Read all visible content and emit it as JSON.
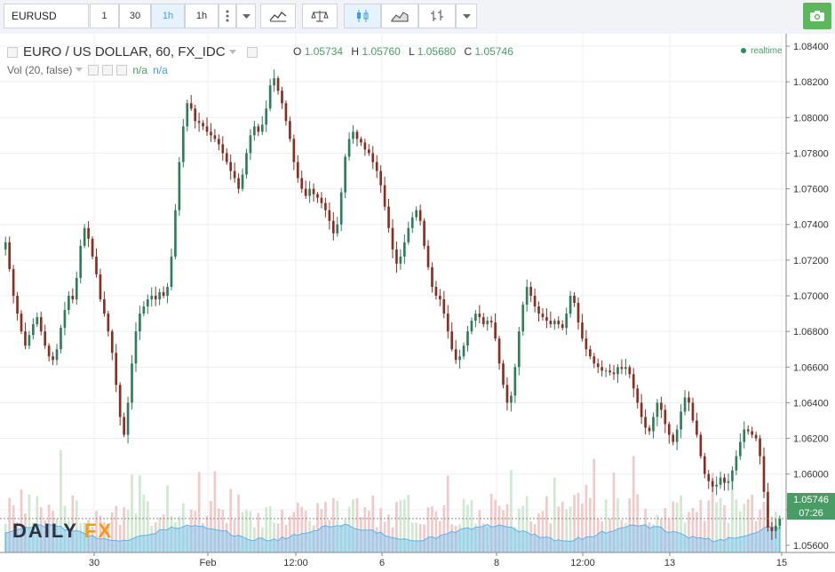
{
  "toolbar": {
    "symbol": "EURUSD",
    "intervals": [
      "1",
      "30",
      "1h",
      "1h"
    ],
    "active_interval_index": 2
  },
  "legend": {
    "title": "EURO / US DOLLAR, 60, FX_IDC",
    "ohlc": {
      "o_label": "O",
      "o": "1.05734",
      "h_label": "H",
      "h": "1.05760",
      "l_label": "L",
      "l": "1.05680",
      "c_label": "C",
      "c": "1.05746"
    },
    "volume_label": "Vol (20, false)",
    "volume_values": [
      "n/a",
      "n/a"
    ],
    "realtime": "realtime"
  },
  "price_tag": {
    "price": "1.05746",
    "countdown": "07:26"
  },
  "brand": {
    "part1": "DAILY",
    "part2": "FX"
  },
  "colors": {
    "up": "#2e7d5b",
    "down": "#8b2e22",
    "volume_up": "#cfe8cf",
    "volume_down": "#f0c9c9",
    "volume_area": "#7fc4ee",
    "accent": "#3aa0e6"
  },
  "chart_data": {
    "type": "candlestick",
    "title": "EURO / US DOLLAR, 60, FX_IDC",
    "y_axis": {
      "ticks": [
        "1.08400",
        "1.08200",
        "1.08000",
        "1.07800",
        "1.07600",
        "1.07400",
        "1.07200",
        "1.07000",
        "1.06800",
        "1.06600",
        "1.06400",
        "1.06200",
        "1.06000",
        "1.05800",
        "1.05600"
      ],
      "ylim": [
        1.0556,
        1.0842
      ]
    },
    "x_axis": {
      "ticks": [
        "30",
        "Feb",
        "12:00",
        "6",
        "8",
        "12:00",
        "13",
        "15"
      ]
    },
    "series": [
      {
        "name": "price",
        "values": [
          1.073,
          1.0715,
          1.07,
          1.069,
          1.068,
          1.0672,
          1.0678,
          1.0684,
          1.0688,
          1.068,
          1.0672,
          1.0666,
          1.0664,
          1.067,
          1.0682,
          1.0692,
          1.07,
          1.0698,
          1.071,
          1.0728,
          1.0738,
          1.0732,
          1.0722,
          1.0712,
          1.0698,
          1.069,
          1.068,
          1.0668,
          1.065,
          1.0632,
          1.0622,
          1.064,
          1.0662,
          1.068,
          1.069,
          1.0694,
          1.0698,
          1.07,
          1.0698,
          1.0702,
          1.07,
          1.0705,
          1.0722,
          1.0748,
          1.0775,
          1.0795,
          1.0808,
          1.0805,
          1.0798,
          1.0797,
          1.0795,
          1.0792,
          1.079,
          1.0788,
          1.0785,
          1.078,
          1.0775,
          1.077,
          1.0766,
          1.076,
          1.0768,
          1.078,
          1.079,
          1.0795,
          1.0792,
          1.0796,
          1.0805,
          1.0818,
          1.0822,
          1.0815,
          1.0808,
          1.0798,
          1.0788,
          1.0775,
          1.0766,
          1.076,
          1.0756,
          1.076,
          1.0757,
          1.0755,
          1.0752,
          1.0748,
          1.0742,
          1.0735,
          1.074,
          1.0758,
          1.0778,
          1.0788,
          1.0792,
          1.0788,
          1.0786,
          1.0782,
          1.078,
          1.0775,
          1.077,
          1.0762,
          1.075,
          1.0738,
          1.0726,
          1.0718,
          1.0722,
          1.073,
          1.0738,
          1.0744,
          1.0748,
          1.0742,
          1.0728,
          1.0716,
          1.0705,
          1.07,
          1.0698,
          1.069,
          1.068,
          1.067,
          1.0664,
          1.0666,
          1.0672,
          1.068,
          1.0686,
          1.069,
          1.0688,
          1.0684,
          1.0686,
          1.0685,
          1.0676,
          1.0662,
          1.065,
          1.064,
          1.0644,
          1.066,
          1.068,
          1.0695,
          1.0705,
          1.07,
          1.0694,
          1.069,
          1.0688,
          1.0686,
          1.0684,
          1.0686,
          1.0684,
          1.0682,
          1.069,
          1.07,
          1.0696,
          1.0685,
          1.0676,
          1.067,
          1.0666,
          1.0662,
          1.066,
          1.0658,
          1.0658,
          1.0657,
          1.0656,
          1.066,
          1.0659,
          1.066,
          1.0656,
          1.0648,
          1.064,
          1.0632,
          1.0626,
          1.0624,
          1.0632,
          1.064,
          1.0636,
          1.0628,
          1.0622,
          1.0618,
          1.0625,
          1.0635,
          1.0643,
          1.064,
          1.063,
          1.0622,
          1.061,
          1.06,
          1.0596,
          1.0593,
          1.0594,
          1.0598,
          1.0595,
          1.0596,
          1.0602,
          1.061,
          1.0618,
          1.0625,
          1.0624,
          1.0622,
          1.062,
          1.061,
          1.059,
          1.057,
          1.0568,
          1.0571,
          1.0575
        ]
      }
    ]
  }
}
